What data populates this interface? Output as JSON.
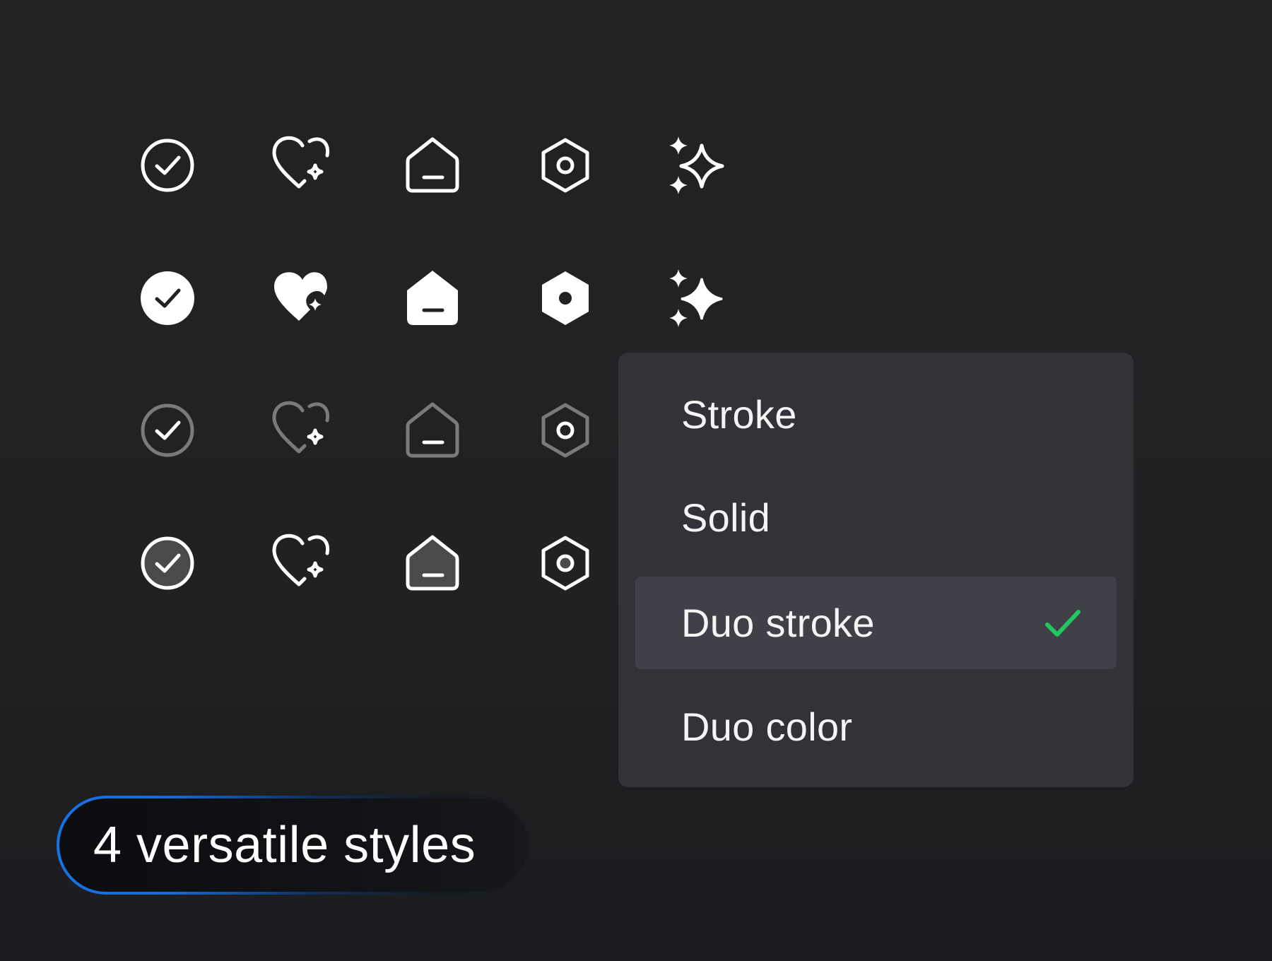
{
  "icon_rows": [
    {
      "style": "stroke",
      "icons": [
        "check-circle-icon",
        "heart-sparkle-icon",
        "home-icon",
        "hexagon-nut-icon",
        "sparkles-icon"
      ]
    },
    {
      "style": "solid",
      "icons": [
        "check-circle-icon",
        "heart-sparkle-icon",
        "home-icon",
        "hexagon-nut-icon",
        "sparkles-icon"
      ]
    },
    {
      "style": "duo-stroke",
      "icons": [
        "check-circle-icon",
        "heart-sparkle-icon",
        "home-icon",
        "hexagon-nut-icon"
      ]
    },
    {
      "style": "duo-color",
      "icons": [
        "check-circle-icon",
        "heart-sparkle-icon",
        "home-icon",
        "hexagon-nut-icon"
      ]
    }
  ],
  "style_menu": {
    "items": [
      {
        "label": "Stroke",
        "selected": false
      },
      {
        "label": "Solid",
        "selected": false
      },
      {
        "label": "Duo stroke",
        "selected": true
      },
      {
        "label": "Duo color",
        "selected": false
      }
    ]
  },
  "badge": {
    "text": "4 versatile styles"
  },
  "colors": {
    "icon_primary": "#ffffff",
    "icon_secondary": "#7a7a7c",
    "duo_fill": "#4a4a4d",
    "menu_bg": "#323338",
    "menu_selected_bg": "#404148",
    "check_green": "#22c55e",
    "badge_border_accent": "#1673e6"
  }
}
